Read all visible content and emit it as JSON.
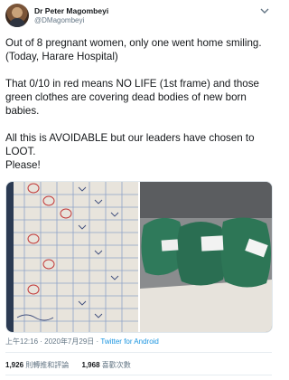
{
  "author": {
    "name": "Dr Peter Magombeyi",
    "handle": "@DMagombeyi"
  },
  "tweet": {
    "paragraphs": [
      "Out of 8 pregnant women, only one went home smiling.  (Today, Harare Hospital)",
      "That 0/10 in red means NO LIFE (1st frame)  and those green clothes are covering dead bodies of new born babies.",
      "All this is AVOIDABLE but our leaders have chosen to LOOT.\nPlease!"
    ]
  },
  "media": {
    "left_photo": "handwritten-chart-photo",
    "right_photo": "green-cloths-photo"
  },
  "meta": {
    "time": "上午12:16",
    "separator": " · ",
    "date": "2020年7月29日",
    "separator2": " · ",
    "source": "Twitter for Android"
  },
  "stats": {
    "retweets_count": "1,926",
    "retweets_label": "則轉推和評論",
    "likes_count": "1,968",
    "likes_label": "喜歡次數"
  }
}
